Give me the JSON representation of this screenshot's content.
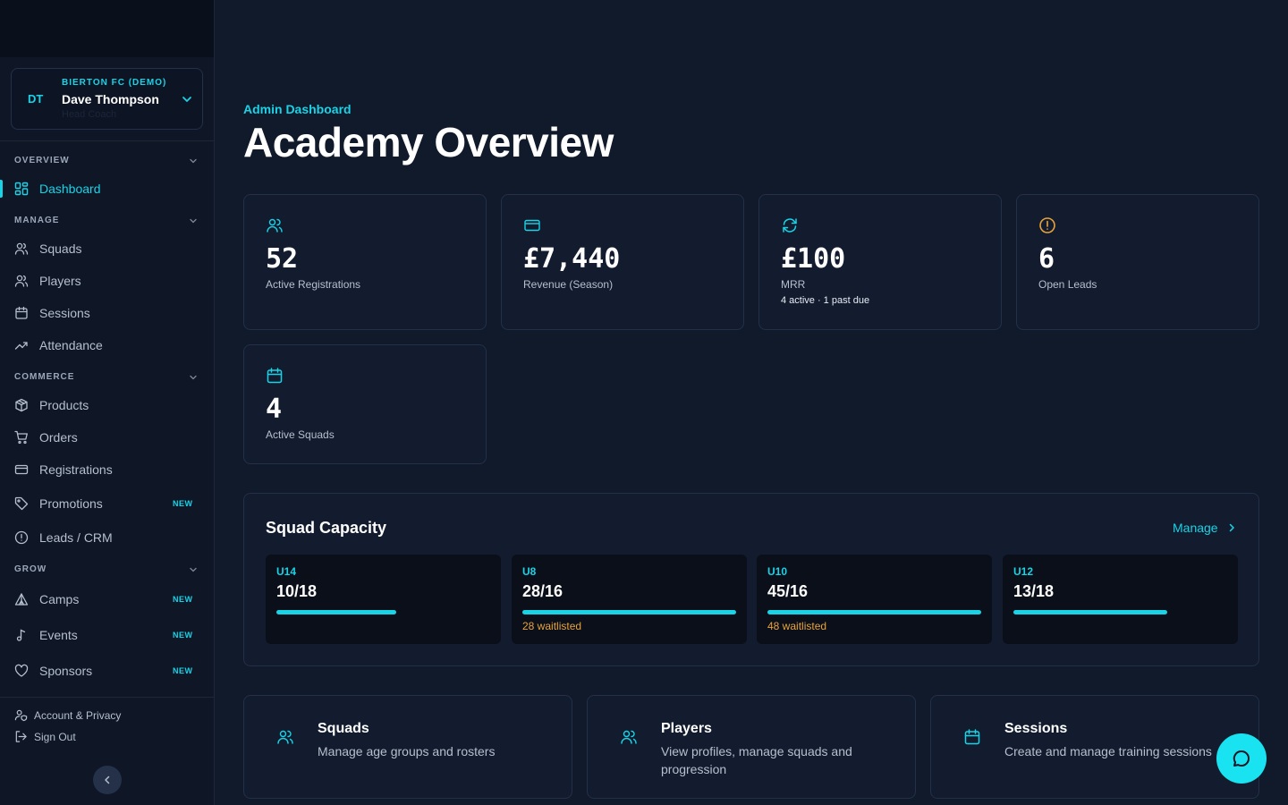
{
  "profile": {
    "initials": "DT",
    "club": "BIERTON FC (DEMO)",
    "name": "Dave Thompson",
    "role": "Head Coach"
  },
  "nav": {
    "overview_label": "OVERVIEW",
    "dashboard": "Dashboard",
    "manage_label": "MANAGE",
    "squads": "Squads",
    "players": "Players",
    "sessions": "Sessions",
    "attendance": "Attendance",
    "commerce_label": "COMMERCE",
    "products": "Products",
    "orders": "Orders",
    "registrations": "Registrations",
    "promotions": "Promotions",
    "leads": "Leads / CRM",
    "grow_label": "GROW",
    "camps": "Camps",
    "events": "Events",
    "sponsors": "Sponsors",
    "new_badge": "NEW",
    "account": "Account & Privacy",
    "signout": "Sign Out"
  },
  "header": {
    "eyebrow": "Admin Dashboard",
    "title": "Academy Overview"
  },
  "stats": [
    {
      "value": "52",
      "label": "Active Registrations",
      "icon": "users-icon"
    },
    {
      "value": "£7,440",
      "label": "Revenue (Season)",
      "icon": "credit-card-icon"
    },
    {
      "value": "£100",
      "label": "MRR",
      "sub": "4 active · 1 past due",
      "icon": "refresh-icon"
    },
    {
      "value": "6",
      "label": "Open Leads",
      "icon": "alert-circle-icon"
    },
    {
      "value": "4",
      "label": "Active Squads",
      "icon": "calendar-icon"
    }
  ],
  "capacity": {
    "title": "Squad Capacity",
    "manage": "Manage",
    "squads": [
      {
        "age": "U14",
        "count": "10/18",
        "fill": 0.56,
        "waitlist": ""
      },
      {
        "age": "U8",
        "count": "28/16",
        "fill": 1.0,
        "waitlist": "28 waitlisted"
      },
      {
        "age": "U10",
        "count": "45/16",
        "fill": 1.0,
        "waitlist": "48 waitlisted"
      },
      {
        "age": "U12",
        "count": "13/18",
        "fill": 0.72,
        "waitlist": ""
      }
    ]
  },
  "quick": [
    {
      "title": "Squads",
      "desc": "Manage age groups and rosters"
    },
    {
      "title": "Players",
      "desc": "View profiles, manage squads and progression"
    },
    {
      "title": "Sessions",
      "desc": "Create and manage training sessions"
    }
  ],
  "colors": {
    "accent": "#19d3e6",
    "warning": "#e8a33c",
    "background": "#111a2b",
    "sidebar": "#0f1727"
  }
}
